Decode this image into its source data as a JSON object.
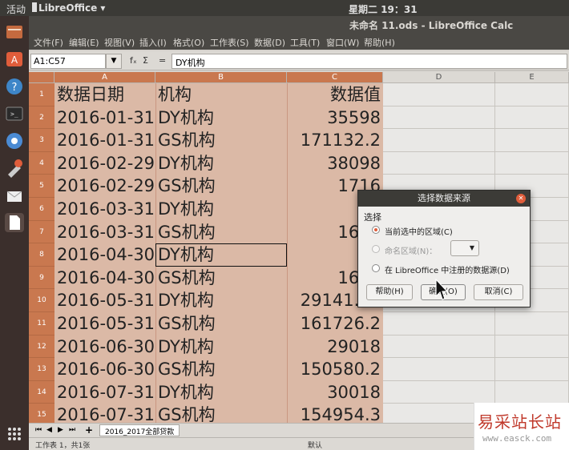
{
  "topbar": {
    "activities": "活动",
    "app_name": "LibreOffice ▾",
    "clock": "星期二 19：31"
  },
  "window": {
    "title": "未命名 11.ods - LibreOffice Calc"
  },
  "menu": [
    "文件(F)",
    "编辑(E)",
    "视图(V)",
    "插入(I)",
    "格式(O)",
    "工作表(S)",
    "数据(D)",
    "工具(T)",
    "窗口(W)",
    "帮助(H)"
  ],
  "formula": {
    "name_box": "A1:C57",
    "fx": "fₓ",
    "sigma": "Σ",
    "equals": "=",
    "content": "DY机构"
  },
  "columns": [
    "A",
    "B",
    "C",
    "D",
    "E"
  ],
  "rows": [
    {
      "n": "1",
      "a": "数据日期",
      "b": "机构",
      "c": "数据值"
    },
    {
      "n": "2",
      "a": "2016-01-31",
      "b": "DY机构",
      "c": "35598"
    },
    {
      "n": "3",
      "a": "2016-01-31",
      "b": "GS机构",
      "c": "171132.2"
    },
    {
      "n": "4",
      "a": "2016-02-29",
      "b": "DY机构",
      "c": "38098"
    },
    {
      "n": "5",
      "a": "2016-02-29",
      "b": "GS机构",
      "c": "1716"
    },
    {
      "n": "6",
      "a": "2016-03-31",
      "b": "DY机构",
      "c": ""
    },
    {
      "n": "7",
      "a": "2016-03-31",
      "b": "GS机构",
      "c": "1685"
    },
    {
      "n": "8",
      "a": "2016-04-30",
      "b": "DY机构",
      "c": ""
    },
    {
      "n": "9",
      "a": "2016-04-30",
      "b": "GS机构",
      "c": "1627"
    },
    {
      "n": "10",
      "a": "2016-05-31",
      "b": "DY机构",
      "c": "29141.35"
    },
    {
      "n": "11",
      "a": "2016-05-31",
      "b": "GS机构",
      "c": "161726.2"
    },
    {
      "n": "12",
      "a": "2016-06-30",
      "b": "DY机构",
      "c": "29018"
    },
    {
      "n": "13",
      "a": "2016-06-30",
      "b": "GS机构",
      "c": "150580.2"
    },
    {
      "n": "14",
      "a": "2016-07-31",
      "b": "DY机构",
      "c": "30018"
    },
    {
      "n": "15",
      "a": "2016-07-31",
      "b": "GS机构",
      "c": "154954.3"
    }
  ],
  "sheet_tab": "2016_2017全部贷款",
  "status": {
    "sheet_info": "工作表 1，共1张",
    "style": "默认"
  },
  "dialog": {
    "title": "选择数据来源",
    "group_label": "选择",
    "opt_current": "当前选中的区域(C)",
    "opt_named": "命名区域(N)：",
    "opt_registered": "在 LibreOffice 中注册的数据源(D)",
    "btn_help": "帮助(H)",
    "btn_ok": "确定(O)",
    "btn_cancel": "取消(C)"
  },
  "watermark": {
    "title": "易采站长站",
    "url": "www.easck.com"
  },
  "colors": {
    "accent": "#e05d3b",
    "selection": "#c9784f"
  }
}
